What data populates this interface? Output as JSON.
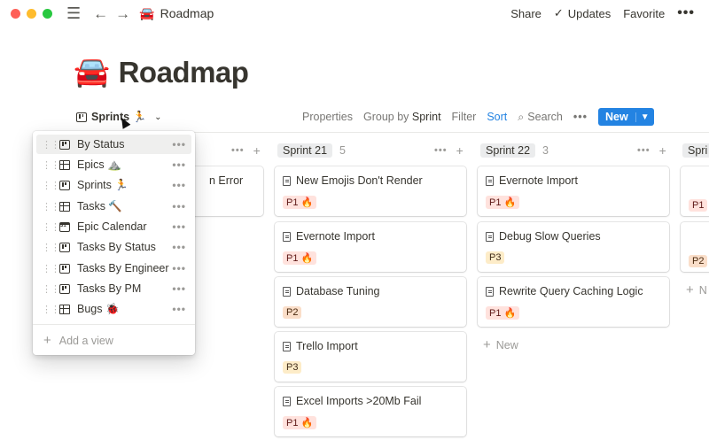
{
  "window": {
    "title": "Roadmap",
    "title_emoji": "🚘"
  },
  "topbar": {
    "share_label": "Share",
    "updates_label": "Updates",
    "favorite_label": "Favorite"
  },
  "page": {
    "title": "Roadmap",
    "emoji": "🚘"
  },
  "view_bar": {
    "current_view": "Sprints 🏃",
    "properties_label": "Properties",
    "group_by_label": "Group by",
    "group_by_value": "Sprint",
    "filter_label": "Filter",
    "sort_label": "Sort",
    "search_label": "Search",
    "new_label": "New"
  },
  "columns": [
    {
      "name": "Sprint 21",
      "count": "5",
      "cards": [
        {
          "title": "New Emojis Don't Render",
          "priority": "P1 🔥",
          "level": "p1"
        },
        {
          "title": "Evernote Import",
          "priority": "P1 🔥",
          "level": "p1"
        },
        {
          "title": "Database Tuning",
          "priority": "P2",
          "level": "p2"
        },
        {
          "title": "Trello Import",
          "priority": "P3",
          "level": "p3"
        },
        {
          "title": "Excel Imports >20Mb Fail",
          "priority": "P1 🔥",
          "level": "p1"
        }
      ]
    },
    {
      "name": "Sprint 22",
      "count": "3",
      "cards": [
        {
          "title": "Evernote Import",
          "priority": "P1 🔥",
          "level": "p1"
        },
        {
          "title": "Debug Slow Queries",
          "priority": "P3",
          "level": "p3"
        },
        {
          "title": "Rewrite Query Caching Logic",
          "priority": "P1 🔥",
          "level": "p1"
        }
      ],
      "new_label": "New"
    }
  ],
  "partial_left": {
    "card_title_fragment": "n Error"
  },
  "partial_right": {
    "header_fragment": "Spri",
    "tags": [
      "P1",
      "P2"
    ],
    "new_fragment": "N"
  },
  "views_menu": {
    "items": [
      {
        "label": "By Status",
        "icon": "board"
      },
      {
        "label": "Epics ⛰️",
        "icon": "table"
      },
      {
        "label": "Sprints 🏃",
        "icon": "board"
      },
      {
        "label": "Tasks 🔨",
        "icon": "table"
      },
      {
        "label": "Epic Calendar",
        "icon": "cal"
      },
      {
        "label": "Tasks By Status",
        "icon": "board"
      },
      {
        "label": "Tasks By Engineer",
        "icon": "board"
      },
      {
        "label": "Tasks By PM",
        "icon": "board"
      },
      {
        "label": "Bugs 🐞",
        "icon": "table"
      }
    ],
    "add_view_label": "Add a view"
  }
}
